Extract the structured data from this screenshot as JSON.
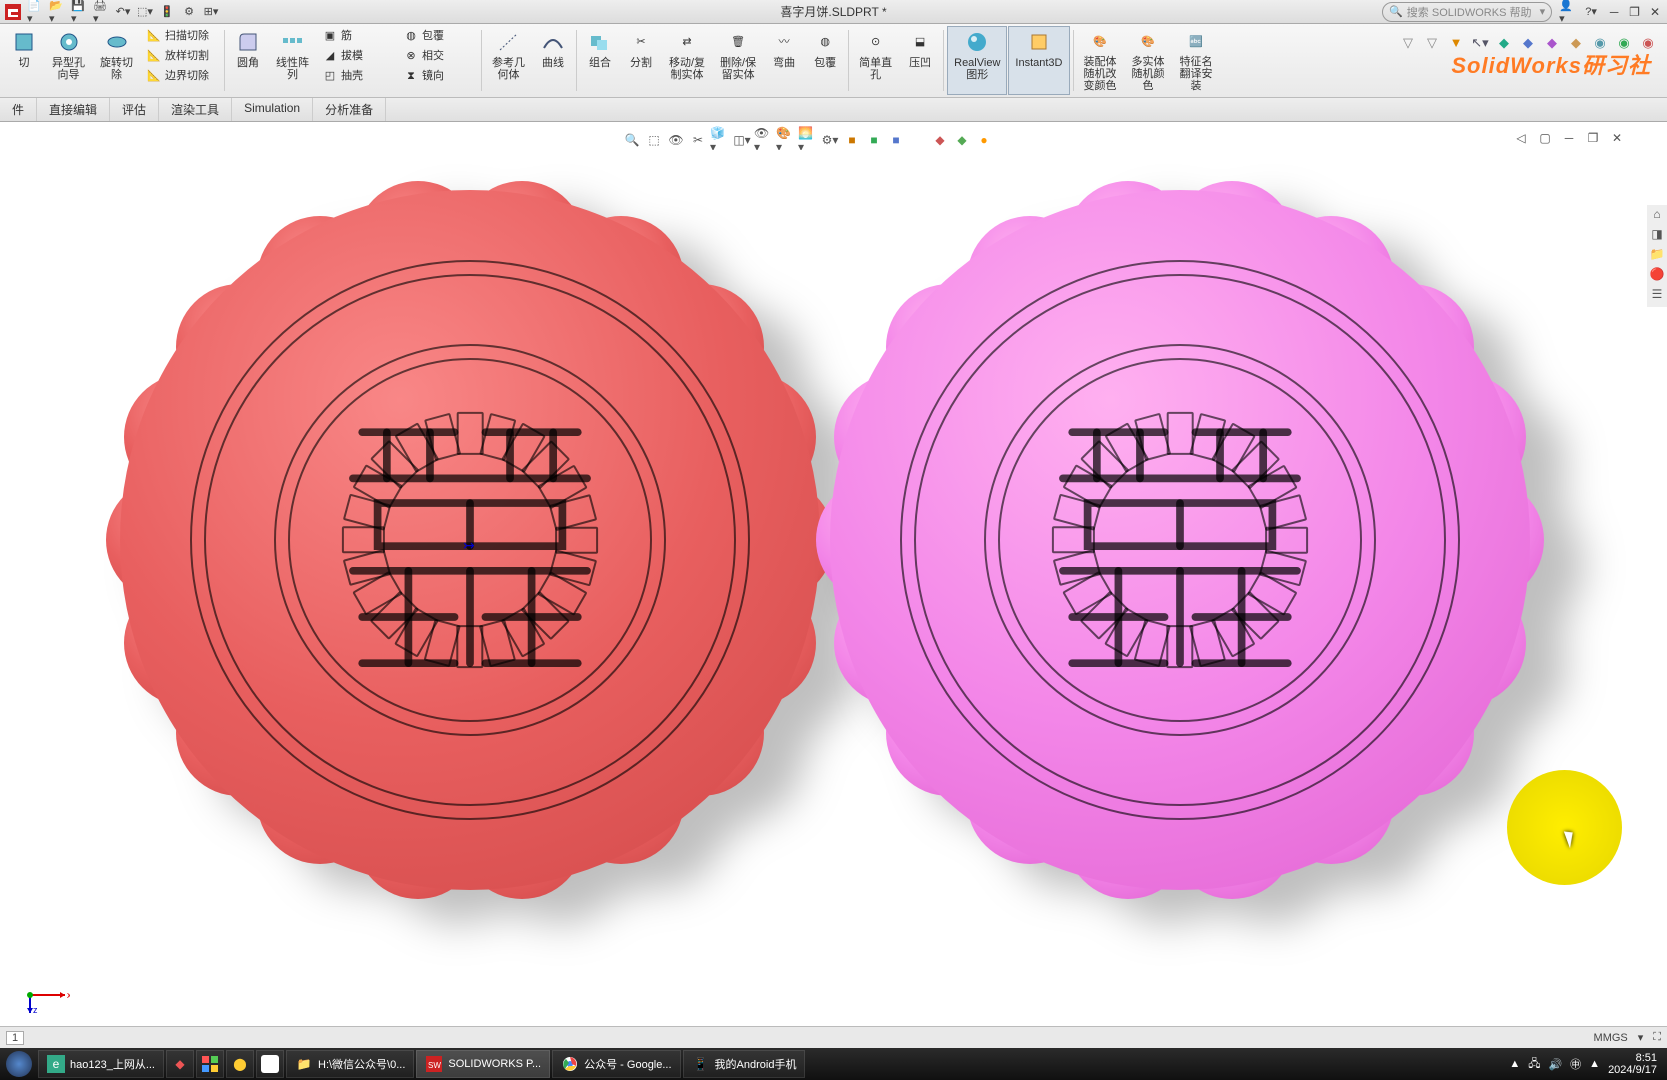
{
  "title_bar": {
    "document": "喜字月饼.SLDPRT *",
    "search_placeholder": "搜索 SOLIDWORKS 帮助"
  },
  "ribbon": {
    "group1": [
      {
        "label": "切"
      },
      {
        "label": "异型孔\n向导"
      },
      {
        "label": "旋转切\n除"
      }
    ],
    "group1b": [
      {
        "label": "扫描切除"
      },
      {
        "label": "放样切割"
      },
      {
        "label": "边界切除"
      }
    ],
    "group2": [
      {
        "label": "圆角"
      },
      {
        "label": "线性阵\n列"
      }
    ],
    "group2b": [
      {
        "label": "筋"
      },
      {
        "label": "拔模"
      },
      {
        "label": "抽壳"
      }
    ],
    "group2c": [
      {
        "label": "包覆"
      },
      {
        "label": "相交"
      },
      {
        "label": "镜向"
      }
    ],
    "group3": [
      {
        "label": "参考几\n何体"
      },
      {
        "label": "曲线"
      }
    ],
    "group4": [
      {
        "label": "组合"
      },
      {
        "label": "分割"
      },
      {
        "label": "移动/复\n制实体"
      },
      {
        "label": "删除/保\n留实体"
      },
      {
        "label": "弯曲"
      },
      {
        "label": "包覆"
      }
    ],
    "group5": [
      {
        "label": "简单直\n孔"
      },
      {
        "label": "压凹"
      }
    ],
    "group6": [
      {
        "label": "RealView\n图形",
        "active": true
      },
      {
        "label": "Instant3D",
        "active": true
      }
    ],
    "group7": [
      {
        "label": "装配体\n随机改\n变颜色"
      },
      {
        "label": "多实体\n随机颜\n色"
      },
      {
        "label": "特征名\n翻译安\n装"
      }
    ]
  },
  "watermark": "SolidWorks研习社",
  "tabs": [
    "件",
    "直接编辑",
    "评估",
    "渲染工具",
    "Simulation",
    "分析准备"
  ],
  "right_panel_icons": [
    "home",
    "view",
    "layers",
    "color",
    "list"
  ],
  "status_bar": {
    "page": "1",
    "units": "MMGS"
  },
  "triad": {
    "x": "x",
    "z": "z"
  },
  "taskbar": {
    "items": [
      {
        "label": "hao123_上网从...",
        "color": "#3a8"
      },
      {
        "label": "",
        "color": "#d44"
      },
      {
        "label": "",
        "color": "#f90"
      },
      {
        "label": "",
        "color": "#fc3"
      },
      {
        "label": "",
        "color": "#fff"
      },
      {
        "label": "H:\\微信公众号\\0...",
        "color": "#fd8"
      },
      {
        "label": "SOLIDWORKS P...",
        "color": "#c22"
      },
      {
        "label": "公众号 - Google...",
        "color": "#fff"
      },
      {
        "label": "我的Android手机",
        "color": "#4af"
      }
    ],
    "tray_icons": [
      "▲",
      "📶",
      "🔊",
      "⌨"
    ],
    "time": "8:51",
    "date": "2024/9/17"
  }
}
